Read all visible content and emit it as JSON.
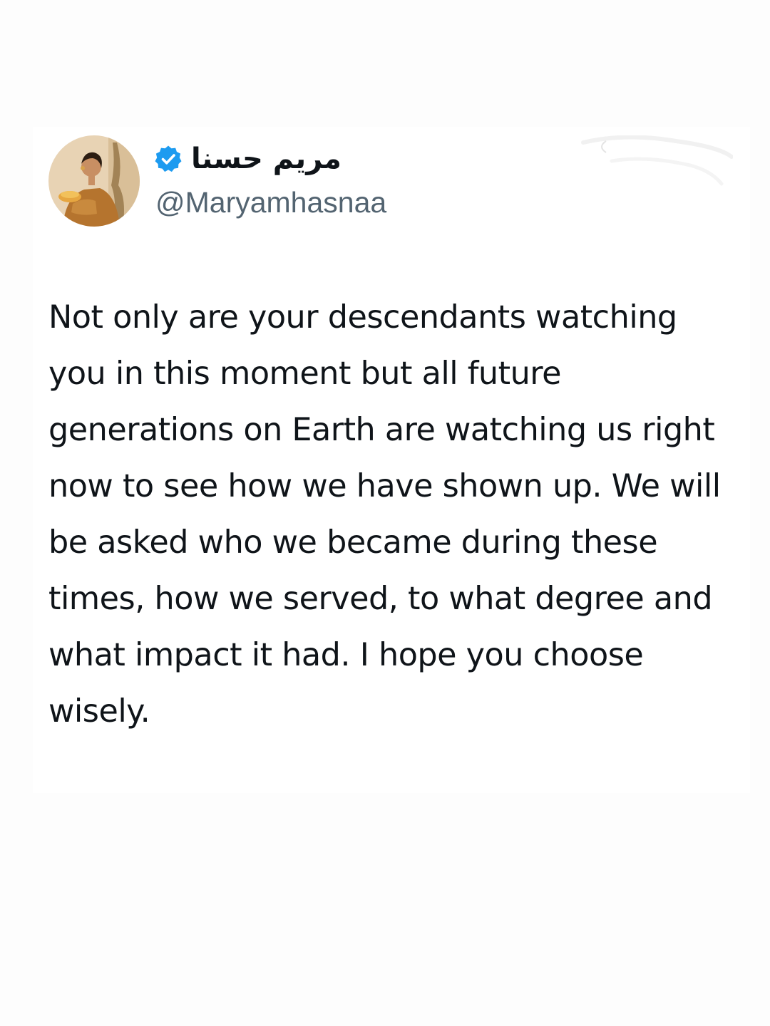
{
  "tweet": {
    "author": {
      "display_name": "مريم حسنا",
      "handle": "@Maryamhasnaa",
      "verified_icon": "verified-badge-icon",
      "avatar_icon": "profile-photo"
    },
    "text": "Not only are your descendants watching you in this moment but all future generations on Earth are watching us right now to see how we have shown up. We will be asked who we became during these times, how we served, to what degree and what impact it had. I hope you choose wisely.",
    "colors": {
      "verified": "#1d9bf0",
      "text": "#0f1419",
      "handle": "#536471"
    }
  }
}
